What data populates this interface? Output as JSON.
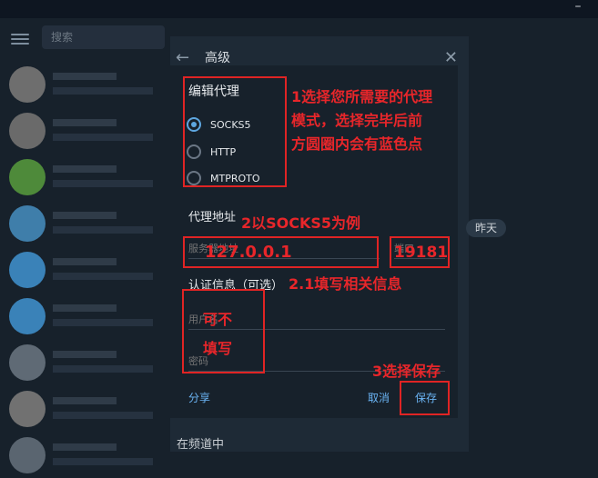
{
  "window": {
    "minimize_label": "–"
  },
  "sidebar": {
    "search_placeholder": "搜索",
    "avatar_colors": [
      "#6e6e6e",
      "#6a6a6a",
      "#4e8a3a",
      "#3f7eaa",
      "#3a82b8",
      "#3a82b8",
      "#5f6a75",
      "#717171",
      "#5a6570"
    ]
  },
  "settings": {
    "title": "高级",
    "day_badge": "昨天",
    "bottom_text": "在频道中"
  },
  "dialog": {
    "title": "编辑代理",
    "options": [
      "SOCKS5",
      "HTTP",
      "MTPROTO"
    ],
    "selected": "SOCKS5",
    "proxy_address_label": "代理地址",
    "server_placeholder": "服务器地址",
    "port_placeholder": "端口",
    "auth_label": "认证信息（可选）",
    "username_placeholder": "用户名",
    "password_placeholder": "密码",
    "share_label": "分享",
    "cancel_label": "取消",
    "save_label": "保存"
  },
  "annotations": {
    "step1_lines": [
      "1选择您所需要的代理",
      "模式，选择完毕后前",
      "方圆圈内会有蓝色点"
    ],
    "step2": "2以SOCKS5为例",
    "server_value": "127.0.0.1",
    "port_value": "19181",
    "step2_1": "2.1填写相关信息",
    "optional_lines": [
      "可不",
      "填写"
    ],
    "step3": "3选择保存"
  }
}
